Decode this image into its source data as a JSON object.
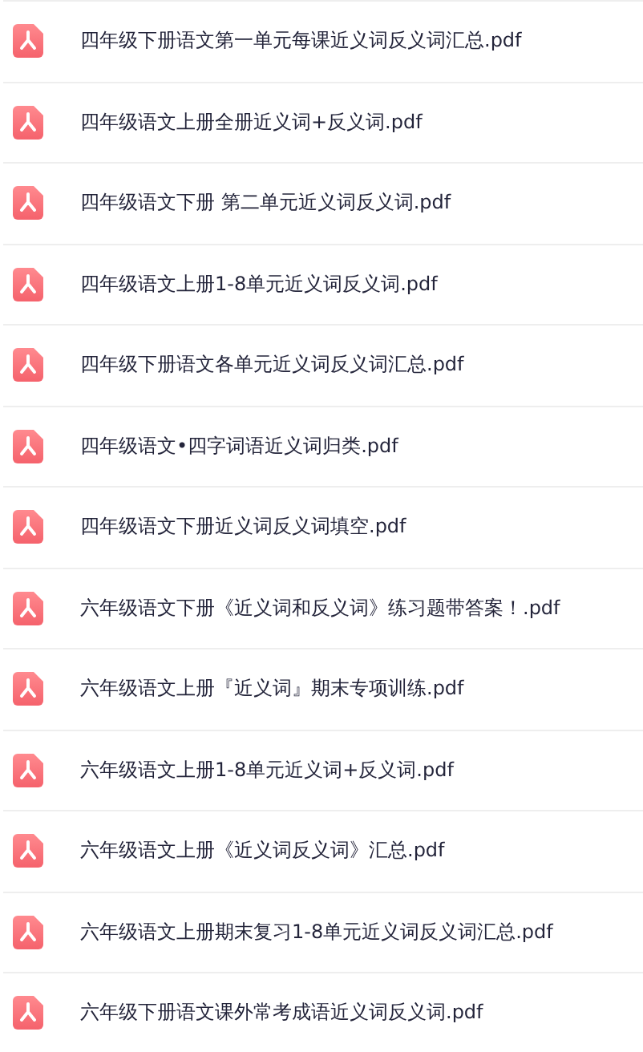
{
  "files": [
    {
      "name": "四年级下册语文第一单元每课近义词反义词汇总.pdf"
    },
    {
      "name": "四年级语文上册全册近义词+反义词.pdf"
    },
    {
      "name": "四年级语文下册 第二单元近义词反义词.pdf"
    },
    {
      "name": "四年级语文上册1-8单元近义词反义词.pdf"
    },
    {
      "name": "四年级下册语文各单元近义词反义词汇总.pdf"
    },
    {
      "name": "四年级语文•四字词语近义词归类.pdf"
    },
    {
      "name": "四年级语文下册近义词反义词填空.pdf"
    },
    {
      "name": "六年级语文下册《近义词和反义词》练习题带答案！.pdf"
    },
    {
      "name": "六年级语文上册『近义词』期末专项训练.pdf"
    },
    {
      "name": "六年级语文上册1-8单元近义词+反义词.pdf"
    },
    {
      "name": "六年级语文上册《近义词反义词》汇总.pdf"
    },
    {
      "name": "六年级语文上册期末复习1-8单元近义词反义词汇总.pdf"
    },
    {
      "name": "六年级下册语文课外常考成语近义词反义词.pdf"
    }
  ]
}
